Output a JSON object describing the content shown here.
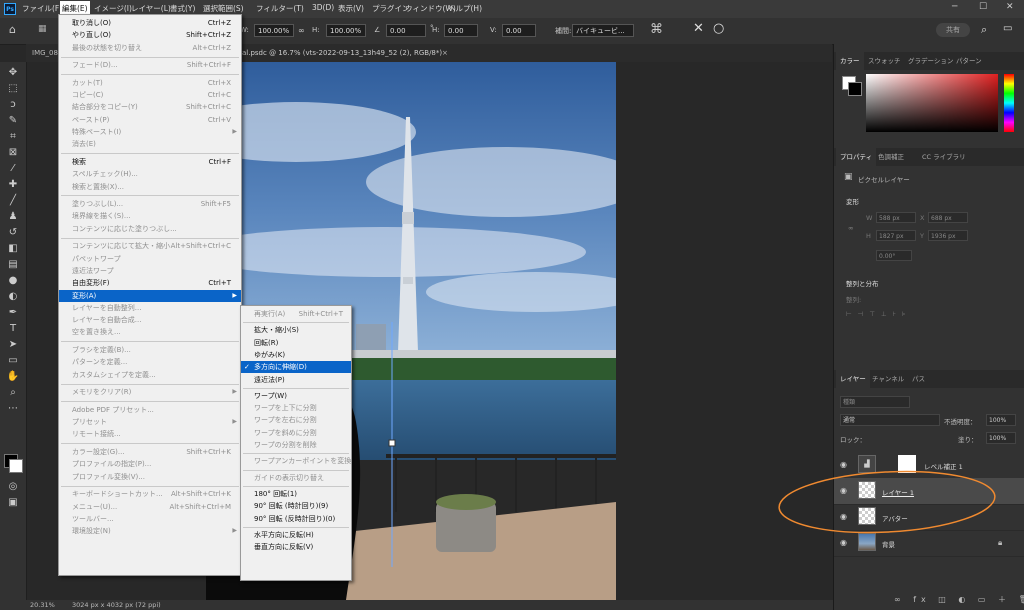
{
  "app": {
    "logo": "Ps"
  },
  "menubar": [
    "ファイル(F)",
    "編集(E)",
    "イメージ(I)",
    "レイヤー(L)",
    "書式(Y)",
    "選択範囲(S)",
    "フィルター(T)",
    "3D(D)",
    "表示(V)",
    "プラグイン",
    "ウィンドウ(W)",
    "ヘルプ(H)"
  ],
  "options": {
    "w_label": "W:",
    "w_value": "100.00%",
    "h_label": "H:",
    "h_value": "100.00%",
    "angle_value": "0.00",
    "h2_label": "H:",
    "h2_value": "0.00",
    "v_label": "V:",
    "v_value": "0.00",
    "interp_label": "補間:",
    "interp_value": "バイキュービ..."
  },
  "share_label": "共有",
  "tabs": {
    "first": "IMG_08",
    "doc": "al.psdc @ 16.7% (vts-2022-09-13_13h49_52 (2), RGB/8*)",
    "close": "×"
  },
  "status": {
    "zoom": "20.31%",
    "info": "3024 px x 4032 px (72 ppi)"
  },
  "edit_menu": [
    {
      "label": "取り消し(O)",
      "sc": "Ctrl+Z",
      "dis": false
    },
    {
      "label": "やり直し(O)",
      "sc": "Shift+Ctrl+Z",
      "dis": false
    },
    {
      "label": "最後の状態を切り替え",
      "sc": "Alt+Ctrl+Z",
      "dis": true
    },
    {
      "sep": true
    },
    {
      "label": "フェード(D)...",
      "sc": "Shift+Ctrl+F",
      "dis": true
    },
    {
      "sep": true
    },
    {
      "label": "カット(T)",
      "sc": "Ctrl+X",
      "dis": true
    },
    {
      "label": "コピー(C)",
      "sc": "Ctrl+C",
      "dis": true
    },
    {
      "label": "結合部分をコピー(Y)",
      "sc": "Shift+Ctrl+C",
      "dis": true
    },
    {
      "label": "ペースト(P)",
      "sc": "Ctrl+V",
      "dis": true
    },
    {
      "label": "特殊ペースト(I)",
      "sc": "",
      "dis": true,
      "arrow": true
    },
    {
      "label": "消去(E)",
      "sc": "",
      "dis": true
    },
    {
      "sep": true
    },
    {
      "label": "検索",
      "sc": "Ctrl+F",
      "dis": false
    },
    {
      "label": "スペルチェック(H)...",
      "sc": "",
      "dis": true
    },
    {
      "label": "検索と置換(X)...",
      "sc": "",
      "dis": true
    },
    {
      "sep": true
    },
    {
      "label": "塗りつぶし(L)...",
      "sc": "Shift+F5",
      "dis": true
    },
    {
      "label": "境界線を描く(S)...",
      "sc": "",
      "dis": true
    },
    {
      "label": "コンテンツに応じた塗りつぶし...",
      "sc": "",
      "dis": true
    },
    {
      "sep": true
    },
    {
      "label": "コンテンツに応じて拡大・縮小",
      "sc": "Alt+Shift+Ctrl+C",
      "dis": true
    },
    {
      "label": "パペットワープ",
      "sc": "",
      "dis": true
    },
    {
      "label": "遠近法ワープ",
      "sc": "",
      "dis": true
    },
    {
      "label": "自由変形(F)",
      "sc": "Ctrl+T",
      "dis": false
    },
    {
      "label": "変形(A)",
      "sc": "",
      "dis": false,
      "arrow": true,
      "hl": true
    },
    {
      "label": "レイヤーを自動整列...",
      "sc": "",
      "dis": true
    },
    {
      "label": "レイヤーを自動合成...",
      "sc": "",
      "dis": true
    },
    {
      "label": "空を置き換え...",
      "sc": "",
      "dis": true
    },
    {
      "sep": true
    },
    {
      "label": "ブラシを定義(B)...",
      "sc": "",
      "dis": true
    },
    {
      "label": "パターンを定義...",
      "sc": "",
      "dis": true
    },
    {
      "label": "カスタムシェイプを定義...",
      "sc": "",
      "dis": true
    },
    {
      "sep": true
    },
    {
      "label": "メモリをクリア(R)",
      "sc": "",
      "dis": true,
      "arrow": true
    },
    {
      "sep": true
    },
    {
      "label": "Adobe PDF プリセット...",
      "sc": "",
      "dis": true
    },
    {
      "label": "プリセット",
      "sc": "",
      "dis": true,
      "arrow": true
    },
    {
      "label": "リモート接続...",
      "sc": "",
      "dis": true
    },
    {
      "sep": true
    },
    {
      "label": "カラー設定(G)...",
      "sc": "Shift+Ctrl+K",
      "dis": true
    },
    {
      "label": "プロファイルの指定(P)...",
      "sc": "",
      "dis": true
    },
    {
      "label": "プロファイル変換(V)...",
      "sc": "",
      "dis": true
    },
    {
      "sep": true
    },
    {
      "label": "キーボードショートカット...",
      "sc": "Alt+Shift+Ctrl+K",
      "dis": true
    },
    {
      "label": "メニュー(U)...",
      "sc": "Alt+Shift+Ctrl+M",
      "dis": true
    },
    {
      "label": "ツールバー...",
      "sc": "",
      "dis": true
    },
    {
      "label": "環境設定(N)",
      "sc": "",
      "dis": true,
      "arrow": true
    }
  ],
  "transform_menu": [
    {
      "label": "再実行(A)",
      "sc": "Shift+Ctrl+T",
      "dis": true
    },
    {
      "sep": true
    },
    {
      "label": "拡大・縮小(S)",
      "sc": "",
      "dis": false
    },
    {
      "label": "回転(R)",
      "sc": "",
      "dis": false
    },
    {
      "label": "ゆがみ(K)",
      "sc": "",
      "dis": false
    },
    {
      "label": "多方向に伸縮(D)",
      "sc": "",
      "dis": false,
      "hl": true,
      "check": true
    },
    {
      "label": "遠近法(P)",
      "sc": "",
      "dis": false
    },
    {
      "sep": true
    },
    {
      "label": "ワープ(W)",
      "sc": "",
      "dis": false
    },
    {
      "label": "ワープを上下に分割",
      "sc": "",
      "dis": true
    },
    {
      "label": "ワープを左右に分割",
      "sc": "",
      "dis": true
    },
    {
      "label": "ワープを斜めに分割",
      "sc": "",
      "dis": true
    },
    {
      "label": "ワープの分割を削除",
      "sc": "",
      "dis": true
    },
    {
      "sep": true
    },
    {
      "label": "ワープアンカーポイントを変換",
      "sc": "",
      "dis": true
    },
    {
      "sep": true
    },
    {
      "label": "ガイドの表示切り替え",
      "sc": "",
      "dis": true
    },
    {
      "sep": true
    },
    {
      "label": "180° 回転(1)",
      "sc": "",
      "dis": false
    },
    {
      "label": "90° 回転 (時計回り)(9)",
      "sc": "",
      "dis": false
    },
    {
      "label": "90° 回転 (反時計回り)(0)",
      "sc": "",
      "dis": false
    },
    {
      "sep": true
    },
    {
      "label": "水平方向に反転(H)",
      "sc": "",
      "dis": false
    },
    {
      "label": "垂直方向に反転(V)",
      "sc": "",
      "dis": false
    }
  ],
  "color_panel": {
    "tabs": [
      "カラー",
      "スウォッチ",
      "グラデーション",
      "パターン"
    ]
  },
  "properties": {
    "tabs": [
      "プロパティ",
      "色調補正",
      "CC ライブラリ"
    ],
    "layer_type": "ピクセルレイヤー",
    "transform_title": "変形",
    "w_label": "W",
    "w_value": "588 px",
    "x_label": "X",
    "x_value": "688 px",
    "h_label": "H",
    "h_value": "1827 px",
    "y_label": "Y",
    "y_value": "1936 px",
    "angle_value": "0.00°",
    "align_title": "整列と分布",
    "align_sub": "整列:"
  },
  "layers_panel": {
    "tabs": [
      "レイヤー",
      "チャンネル",
      "パス"
    ],
    "search_placeholder": "種類",
    "blend_mode": "通常",
    "opacity_label": "不透明度：",
    "opacity_value": "100%",
    "lock_label": "ロック：",
    "fill_label": "塗り：",
    "fill_value": "100%"
  },
  "layers": [
    "レベル補正 1",
    "レイヤー 1",
    "アバター",
    "背景"
  ]
}
